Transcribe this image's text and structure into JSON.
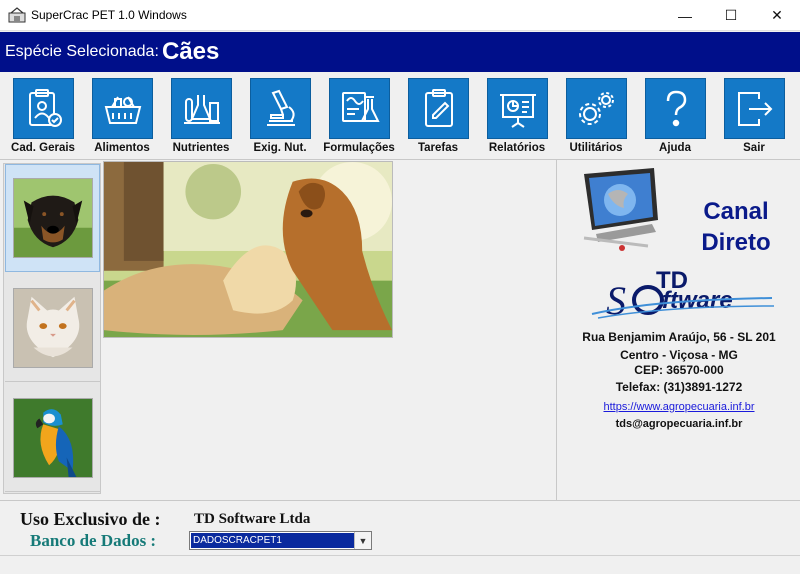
{
  "window": {
    "title": "SuperCrac PET 1.0 Windows",
    "controls": {
      "minimize": "—",
      "maximize": "☐",
      "close": "✕"
    }
  },
  "species_bar": {
    "label": "Espécie Selecionada:",
    "value": "Cães"
  },
  "toolbar": {
    "items": [
      {
        "label": "Cad. Gerais",
        "icon": "clipboard-user-icon"
      },
      {
        "label": "Alimentos",
        "icon": "food-basket-icon"
      },
      {
        "label": "Nutrientes",
        "icon": "lab-glassware-icon"
      },
      {
        "label": "Exig. Nut.",
        "icon": "microscope-icon"
      },
      {
        "label": "Formulações",
        "icon": "formula-flask-icon"
      },
      {
        "label": "Tarefas",
        "icon": "task-clipboard-icon"
      },
      {
        "label": "Relatórios",
        "icon": "presentation-chart-icon"
      },
      {
        "label": "Utilitários",
        "icon": "gears-icon"
      },
      {
        "label": "Ajuda",
        "icon": "question-icon"
      },
      {
        "label": "Sair",
        "icon": "exit-icon"
      }
    ]
  },
  "species_list": [
    {
      "name": "dog",
      "selected": true
    },
    {
      "name": "cat",
      "selected": false
    },
    {
      "name": "parrot",
      "selected": false
    }
  ],
  "contact": {
    "canal_line1": "Canal",
    "canal_line2": "Direto",
    "company_logo_text": "TD Software",
    "address_line1": "Rua Benjamim Araújo, 56 - SL 201",
    "address_line2": "Centro - Viçosa - MG",
    "cep": "CEP: 36570-000",
    "telefax": "Telefax: (31)3891-1272",
    "website": "https://www.agropecuaria.inf.br",
    "email": "tds@agropecuaria.inf.br"
  },
  "footer": {
    "uso_label": "Uso Exclusivo de :",
    "uso_value": "TD Software Ltda",
    "banco_label": "Banco de Dados :",
    "banco_value": "DADOSCRACPET1"
  },
  "colors": {
    "species_bar": "#000f8a",
    "tile_blue": "#1479c7",
    "canal_text": "#0a1a8a",
    "banco_label": "#167a78"
  }
}
